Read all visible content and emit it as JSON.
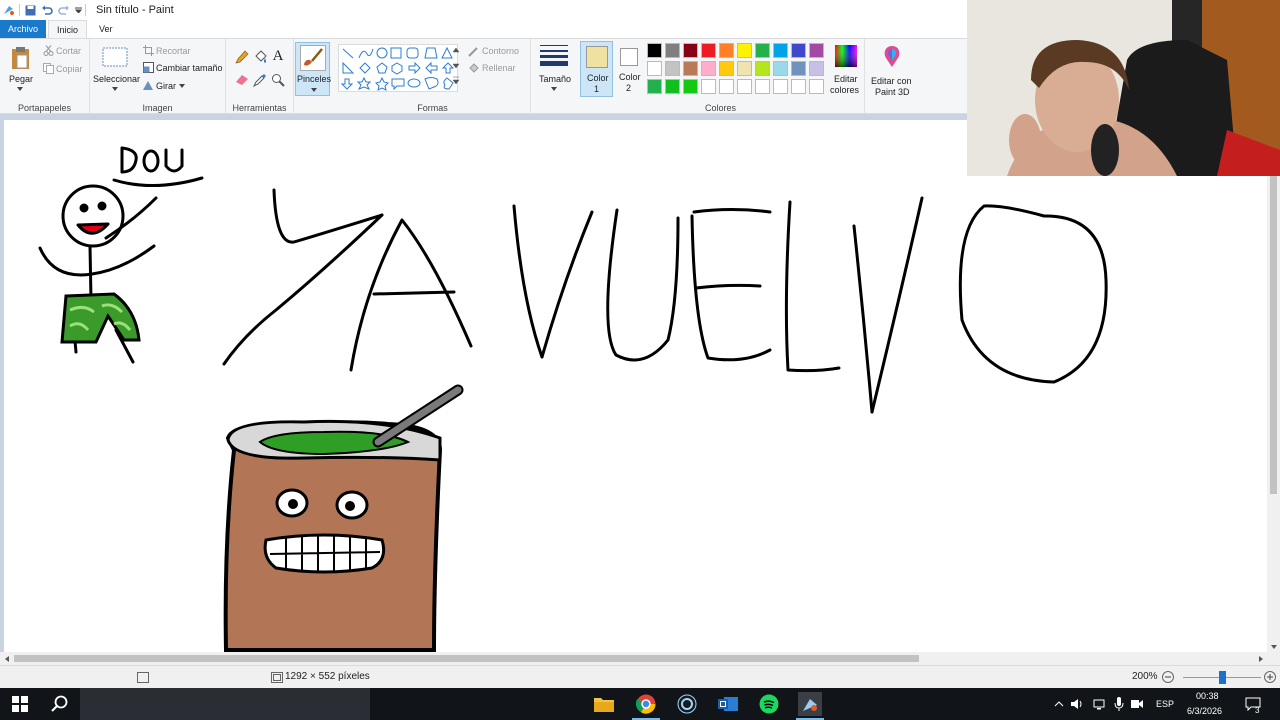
{
  "window": {
    "title": "Sin título - Paint"
  },
  "tabs": {
    "file": "Archivo",
    "home": "Inicio",
    "view": "Ver"
  },
  "ribbon": {
    "clipboard": {
      "paste": "Pegar",
      "cut": "Cortar",
      "copy": "Copiar",
      "group": "Portapapeles"
    },
    "image": {
      "select": "Seleccionar",
      "crop": "Recortar",
      "resize": "Cambiar tamaño",
      "rotate": "Girar",
      "group": "Imagen"
    },
    "tools": {
      "group": "Herramientas",
      "brushes": "Pinceles"
    },
    "shapes": {
      "outline": "Contorno",
      "fill": "Rellenar",
      "group": "Formas"
    },
    "size": {
      "label": "Tamaño"
    },
    "colors": {
      "color1_line1": "Color",
      "color1_line2": "1",
      "color2_line1": "Color",
      "color2_line2": "2",
      "edit_line1": "Editar",
      "edit_line2": "colores",
      "group": "Colores",
      "color1_value": "#f0e1a0",
      "color2_value": "#ffffff",
      "palette_row1": [
        "#000000",
        "#7f7f7f",
        "#880015",
        "#ed1c24",
        "#ff7f27",
        "#fff200",
        "#22b14c",
        "#00a2e8",
        "#3f48cc",
        "#a349a4"
      ],
      "palette_row2": [
        "#ffffff",
        "#c3c3c3",
        "#b97a57",
        "#ffaec9",
        "#ffc90e",
        "#efe4b0",
        "#b5e61d",
        "#99d9ea",
        "#7092be",
        "#c8bfe7"
      ],
      "palette_row3": [
        "#22b14c",
        "#0fbf1f",
        "#14c814",
        "#ffffff",
        "#ffffff",
        "#ffffff",
        "#ffffff",
        "#ffffff",
        "#ffffff",
        "#ffffff"
      ]
    },
    "paint3d": {
      "line1": "Editar con",
      "line2": "Paint 3D"
    }
  },
  "status": {
    "dimensions": "1292 × 552 píxeles",
    "zoom": "200%",
    "zoom_level_pct": 50
  },
  "taskbar": {
    "lang": "ESP",
    "time": "00:38",
    "date": "6/3/2026",
    "notifications": "3"
  }
}
